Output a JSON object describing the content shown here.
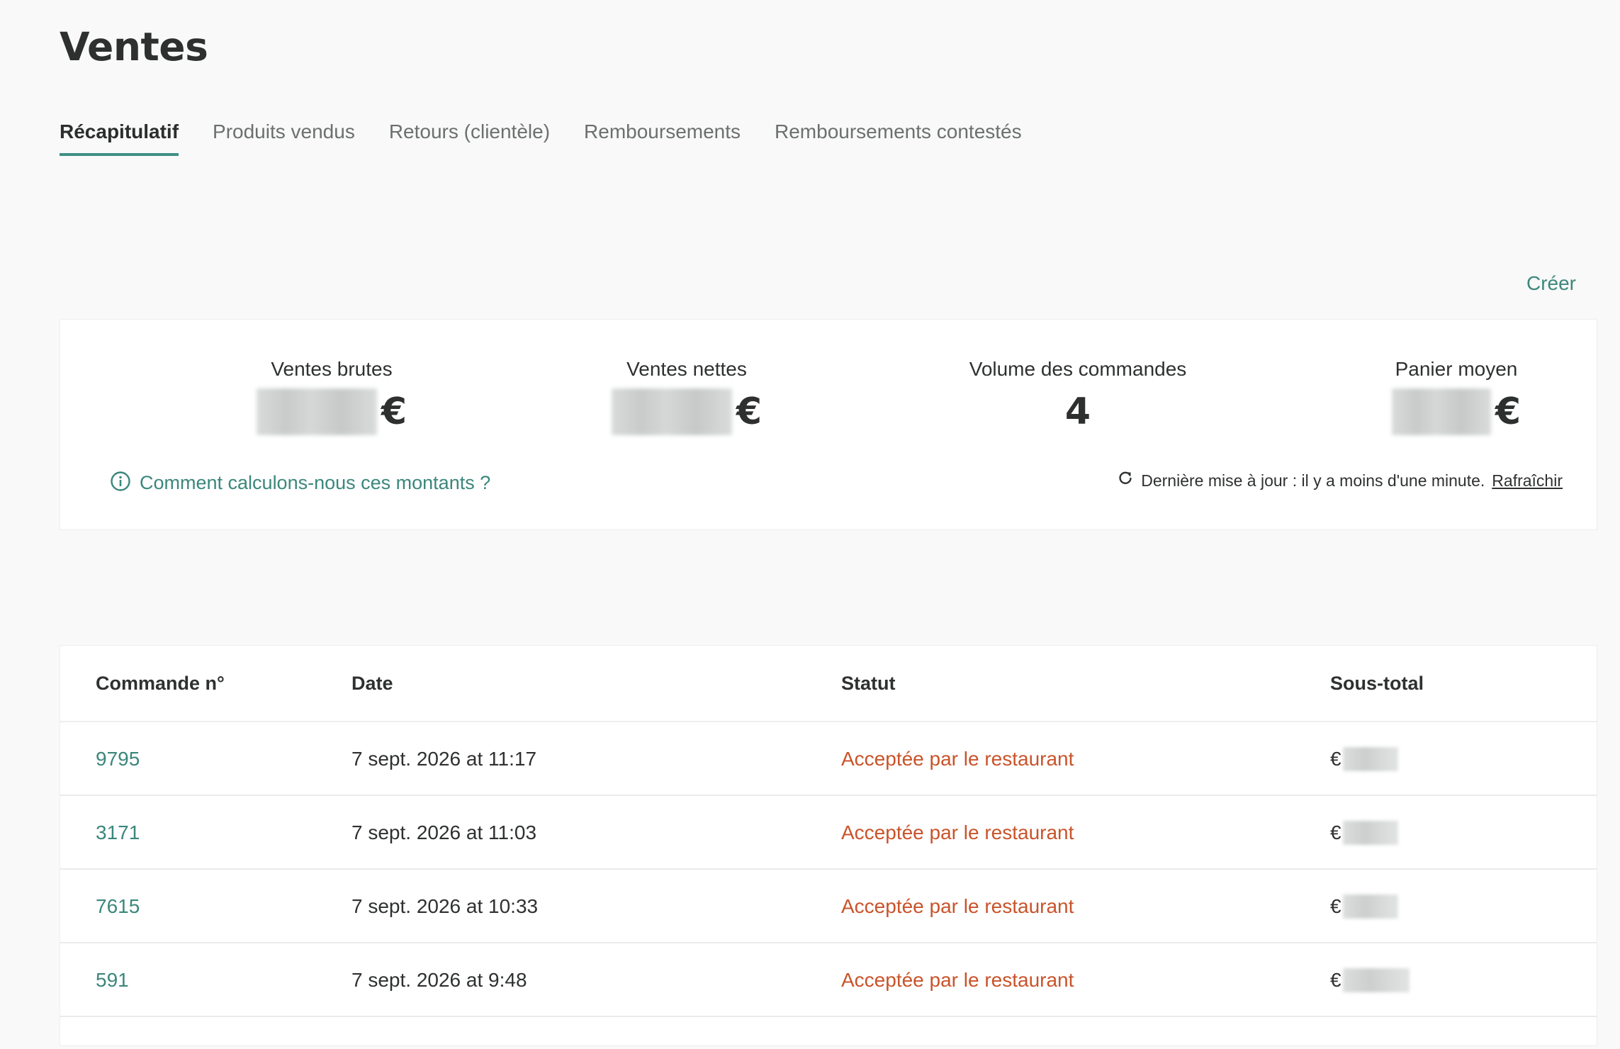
{
  "page": {
    "title": "Ventes"
  },
  "tabs": [
    {
      "label": "Récapitulatif",
      "active": true
    },
    {
      "label": "Produits vendus",
      "active": false
    },
    {
      "label": "Retours (clientèle)",
      "active": false
    },
    {
      "label": "Remboursements",
      "active": false
    },
    {
      "label": "Remboursements contestés",
      "active": false
    }
  ],
  "actions": {
    "create_label": "Créer"
  },
  "summary": {
    "metrics": [
      {
        "label": "Ventes brutes",
        "value_hidden": true,
        "currency": "€"
      },
      {
        "label": "Ventes nettes",
        "value_hidden": true,
        "currency": "€"
      },
      {
        "label": "Volume des commandes",
        "value": "4"
      },
      {
        "label": "Panier moyen",
        "value_hidden": true,
        "currency": "€"
      }
    ],
    "info_link": "Comment calculons-nous ces montants ?",
    "last_update": "Dernière mise à jour : il y a moins d'une minute.",
    "refresh_label": "Rafraîchir"
  },
  "table": {
    "columns": [
      "Commande n°",
      "Date",
      "Statut",
      "Sous-total"
    ],
    "rows": [
      {
        "order": "9795",
        "date": "7 sept. 2026 at 11:17",
        "status": "Acceptée par le restaurant",
        "currency": "€",
        "subtotal_hidden": true
      },
      {
        "order": "3171",
        "date": "7 sept. 2026 at 11:03",
        "status": "Acceptée par le restaurant",
        "currency": "€",
        "subtotal_hidden": true
      },
      {
        "order": "7615",
        "date": "7 sept. 2026 at 10:33",
        "status": "Acceptée par le restaurant",
        "currency": "€",
        "subtotal_hidden": true
      },
      {
        "order": "591",
        "date": "7 sept. 2026 at 9:48",
        "status": "Acceptée par le restaurant",
        "currency": "€",
        "subtotal_hidden": true
      }
    ]
  },
  "colors": {
    "accent": "#3b877c",
    "status": "#c9532a",
    "background": "#f8f9f8"
  },
  "icons": {
    "info": "info-circle-icon",
    "refresh": "refresh-icon"
  }
}
